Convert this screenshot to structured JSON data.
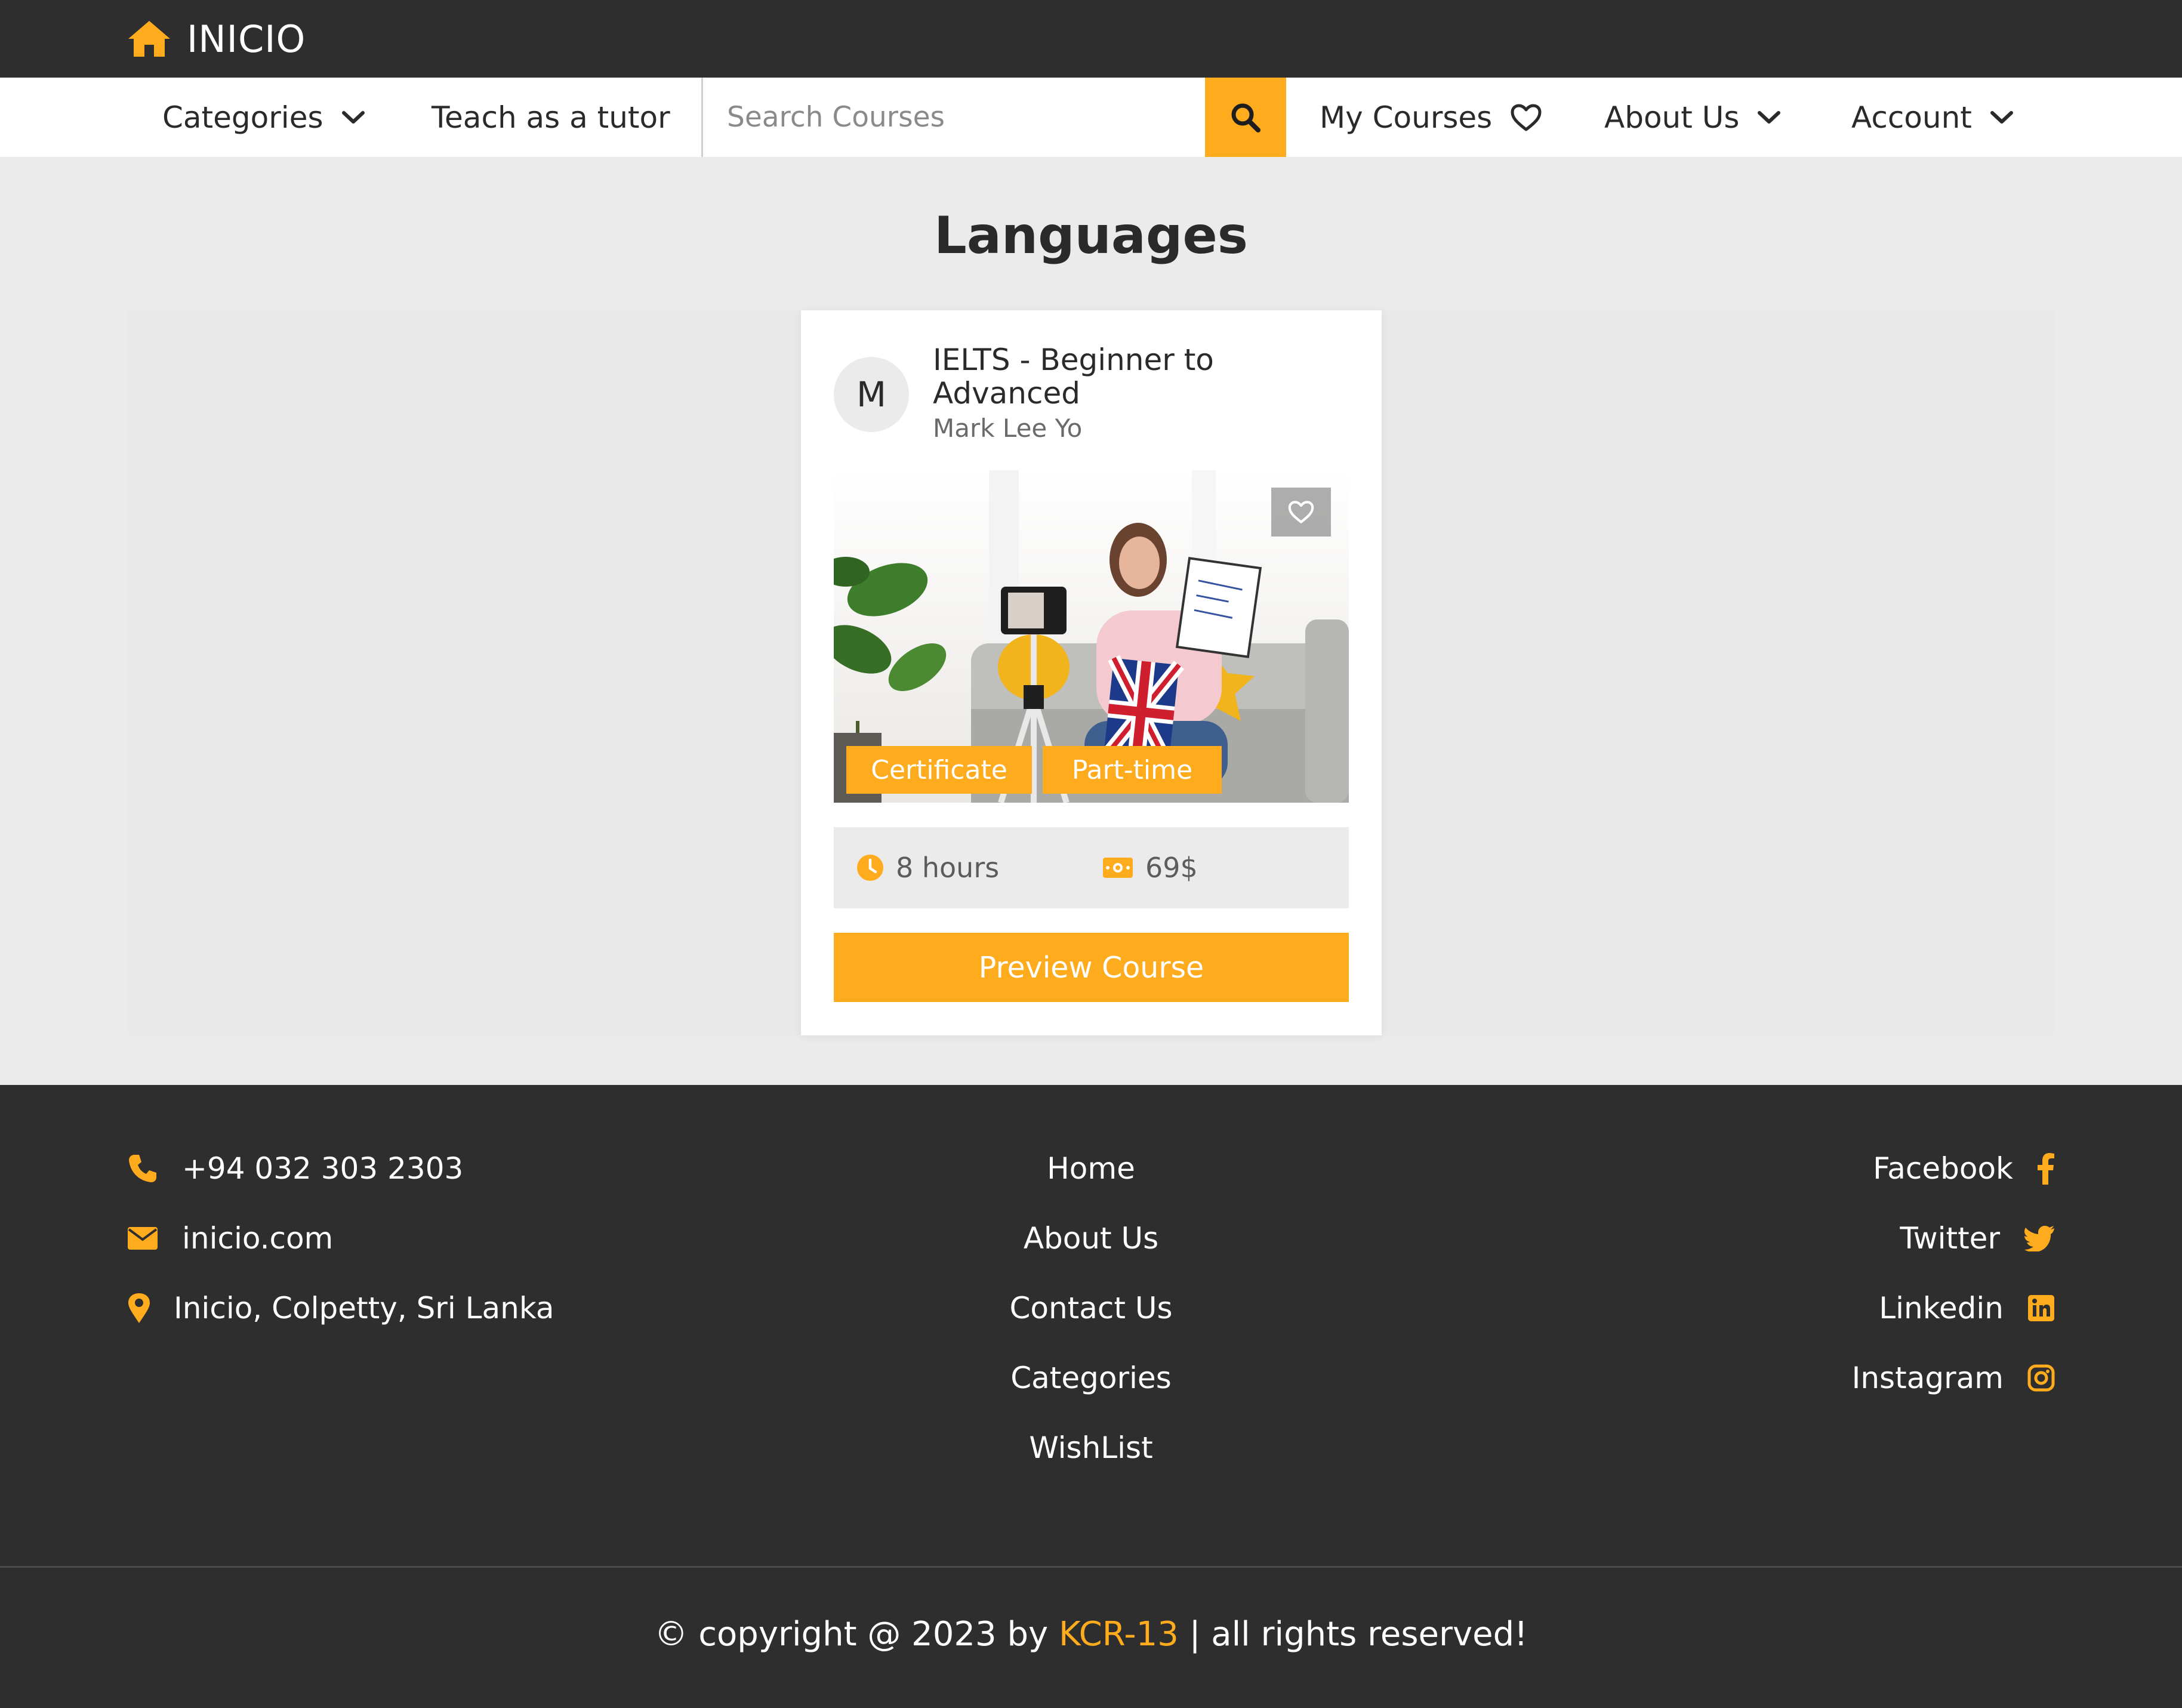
{
  "colors": {
    "accent": "#ffab1e",
    "dark": "#2e2e2e",
    "background": "#ebebeb"
  },
  "brand": {
    "name": "INICIO",
    "icon": "home-icon"
  },
  "nav": {
    "categories": "Categories",
    "teach": "Teach as a tutor",
    "search_placeholder": "Search Courses",
    "my_courses": "My Courses",
    "about": "About Us",
    "account": "Account"
  },
  "main": {
    "title": "Languages",
    "course": {
      "avatar_letter": "M",
      "title": "IELTS - Beginner to Advanced",
      "tutor": "Mark Lee Yo",
      "tags": [
        "Certificate",
        "Part-time"
      ],
      "duration": "8 hours",
      "price": "69$",
      "cta": "Preview Course"
    }
  },
  "footer": {
    "contact": {
      "phone": "+94 032 303 2303",
      "email": "inicio.com",
      "address": "Inicio, Colpetty, Sri Lanka"
    },
    "links": [
      "Home",
      "About Us",
      "Contact Us",
      "Categories",
      "WishList"
    ],
    "social": [
      "Facebook",
      "Twitter",
      "Linkedin",
      "Instagram"
    ],
    "copyright_prefix": "© copyright @ 2023 by ",
    "copyright_brand": "KCR-13",
    "copyright_suffix": " | all rights reserved!"
  }
}
